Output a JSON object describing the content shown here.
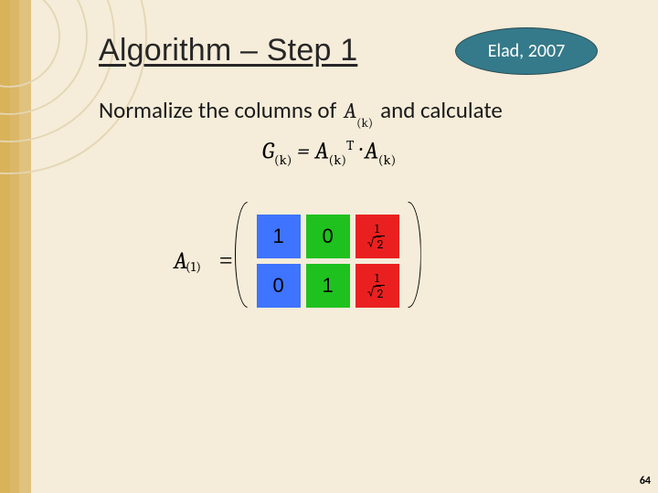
{
  "title": "Algorithm – Step 1",
  "badge": "Elad, 2007",
  "para": {
    "before": "Normalize the columns of",
    "Aexpr_A": "A",
    "Aexpr_sub": "(k)",
    "after": "and calculate"
  },
  "equation": {
    "G": "G",
    "Gsub": "(k)",
    "eq": " = ",
    "A1": "A",
    "A1sub": "(k)",
    "T": "T",
    "dot": " · ",
    "A2": "A",
    "A2sub": "(k)"
  },
  "matrix": {
    "label_A": "A",
    "label_sub": "(1)",
    "eq": "=",
    "col0": [
      "1",
      "0"
    ],
    "col1": [
      "0",
      "1"
    ],
    "col2": {
      "top": {
        "num": "1",
        "den": "2"
      },
      "bot": {
        "num": "1",
        "den": "2"
      }
    }
  },
  "pagenum": "64"
}
